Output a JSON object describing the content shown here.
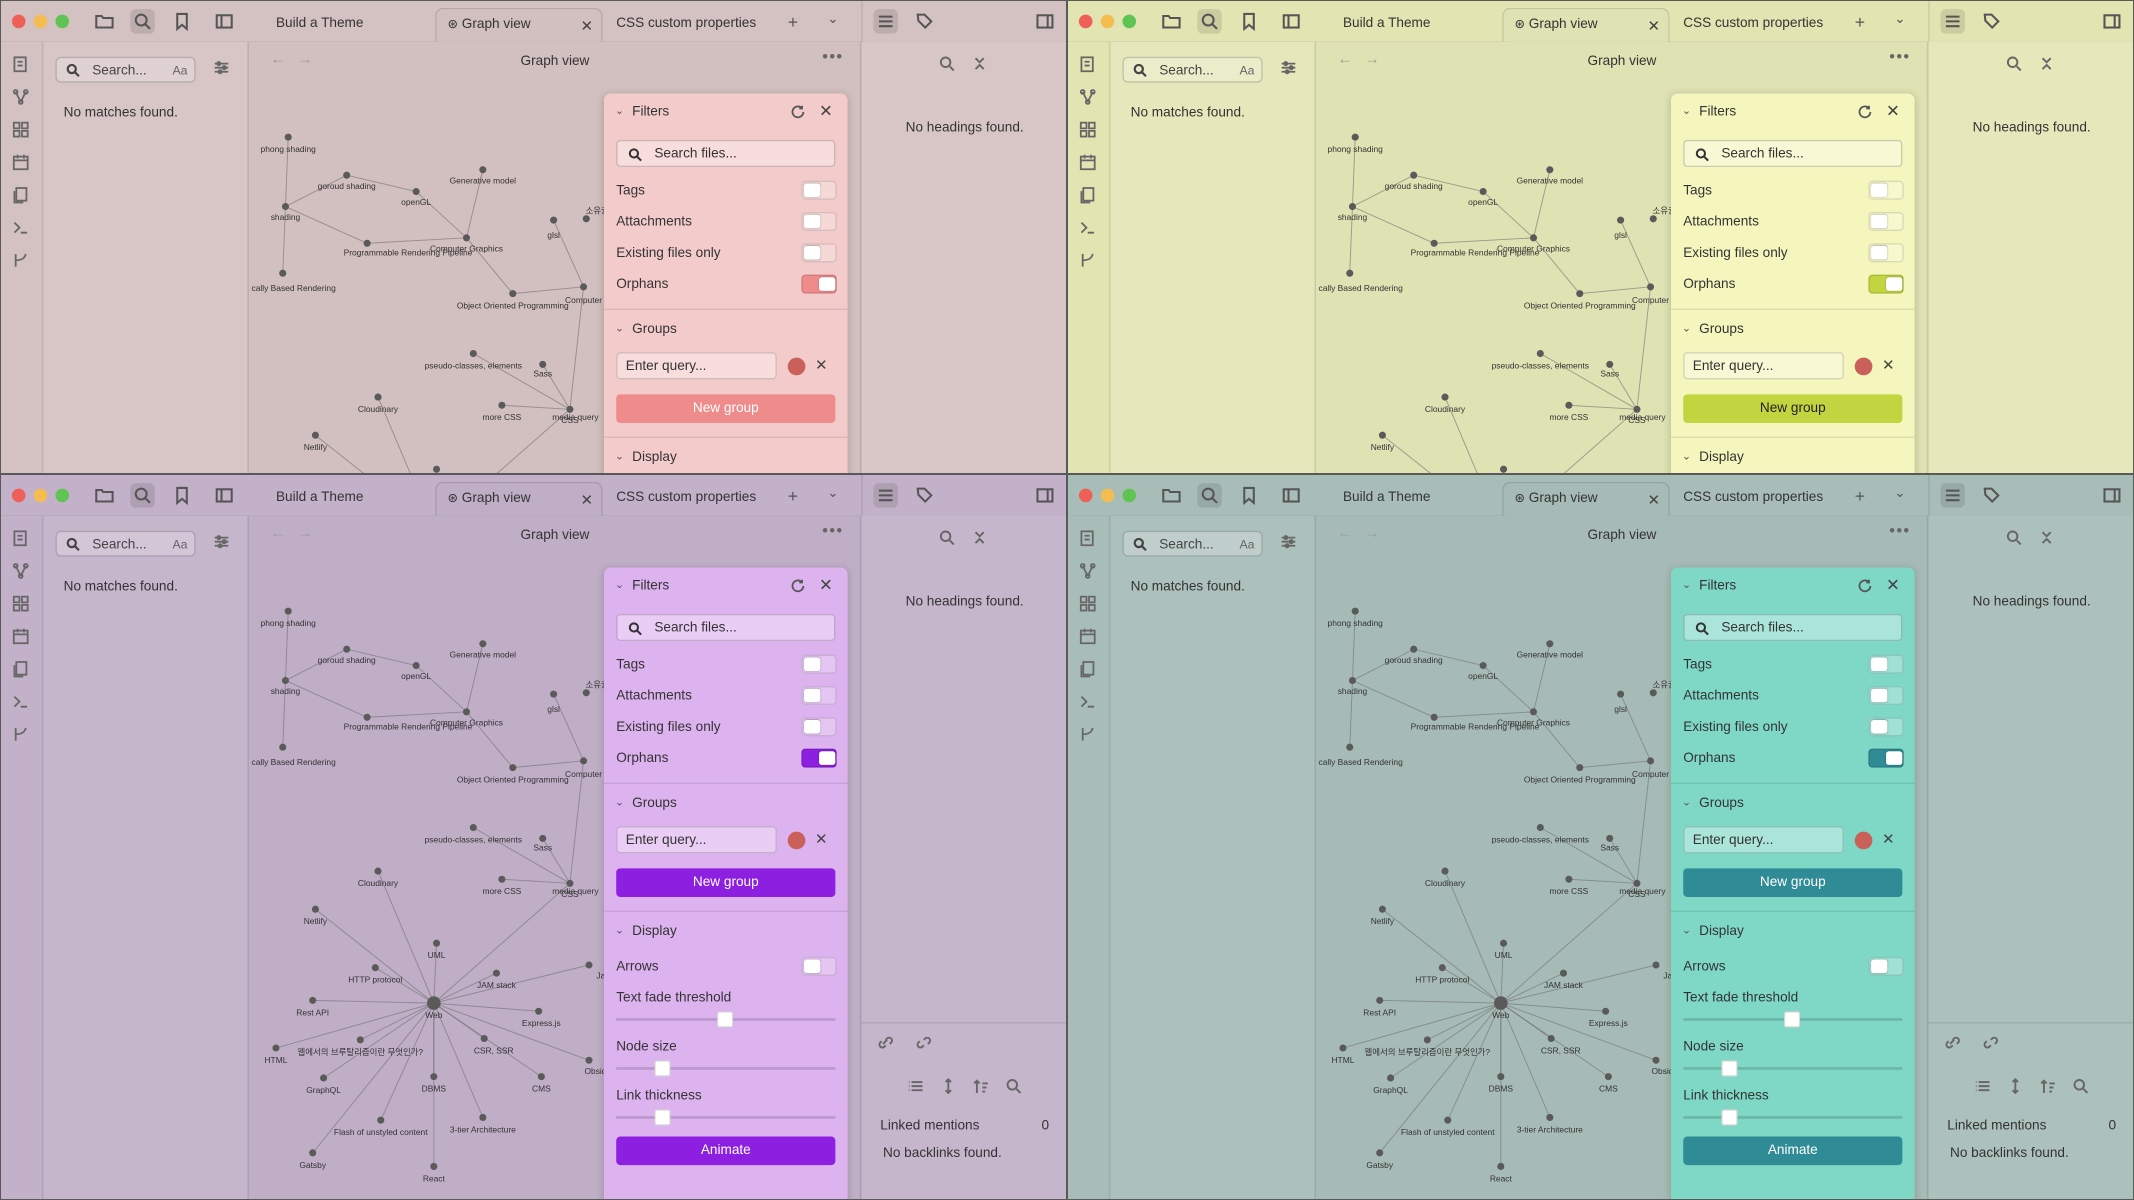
{
  "window": {
    "tabs": [
      "Build a Theme",
      "Graph view",
      "CSS custom properties"
    ],
    "active_tab": "Graph view"
  },
  "left_sidebar": {
    "search_placeholder": "Search...",
    "match_case_label": "Aa",
    "no_matches": "No matches found."
  },
  "main": {
    "title": "Graph view"
  },
  "filters": {
    "title": "Filters",
    "search_placeholder": "Search files...",
    "tags_label": "Tags",
    "attachments_label": "Attachments",
    "existing_label": "Existing files only",
    "orphans_label": "Orphans",
    "tags_on": false,
    "attachments_on": false,
    "existing_on": false,
    "orphans_on": true,
    "groups_title": "Groups",
    "query_placeholder": "Enter query...",
    "group_color": "#c9605a",
    "new_group_label": "New group",
    "display_title": "Display",
    "arrows_label": "Arrows",
    "arrows_on": false,
    "text_fade_label": "Text fade threshold",
    "node_size_label": "Node size",
    "link_thickness_label": "Link thickness",
    "animate_label": "Animate"
  },
  "outline": {
    "no_headings": "No headings found."
  },
  "backlinks": {
    "linked_mentions_label": "Linked mentions",
    "linked_mentions_count": "0",
    "no_backlinks": "No backlinks found."
  },
  "graph_labels": [
    "phong shading",
    "goroud shading",
    "Generative model",
    "openGL",
    "shading",
    "Programmable Rendering Pipeline",
    "Computer Graphics",
    "glsl",
    "cally Based Rendering",
    "Object Oriented Programming",
    "Computer",
    "pseudo-classes, elements",
    "Sass",
    "media query",
    "Cloudinary",
    "more CSS",
    "CSS",
    "Netlify",
    "UML",
    "HTTP protocol",
    "JAM stack",
    "Rest API",
    "Web",
    "Express.js",
    "HTML",
    "웹에서의 브루탈리즘이란 무엇인가?",
    "CSR, SSR",
    "GraphQL",
    "DBMS",
    "CMS",
    "Flash of unstyled content",
    "3-tier Architecture",
    "Gatsby",
    "React",
    "Obsidian D",
    "Java",
    "소유권"
  ],
  "themes": [
    {
      "name": "pink",
      "chrome": "#d4c1c1",
      "side": "#d8c6c6",
      "panel": "#d2bfbf",
      "filt": "#f3cbca",
      "accent": "#ef8b8b",
      "btntext": "#ffffff"
    },
    {
      "name": "lime",
      "chrome": "#e2e4b2",
      "side": "#e6e8bc",
      "panel": "#dfe2b3",
      "filt": "#f4f6bd",
      "accent": "#c3d441",
      "btntext": "#222222"
    },
    {
      "name": "purple",
      "chrome": "#c2b1c8",
      "side": "#c6b6cc",
      "panel": "#bfaec6",
      "filt": "#ddb3ef",
      "accent": "#8c1fe0",
      "btntext": "#ffffff"
    },
    {
      "name": "teal",
      "chrome": "#a9bdb8",
      "side": "#adc1bc",
      "panel": "#a7bbb6",
      "filt": "#7fd8c6",
      "accent": "#2f8b95",
      "btntext": "#ffffff"
    }
  ]
}
